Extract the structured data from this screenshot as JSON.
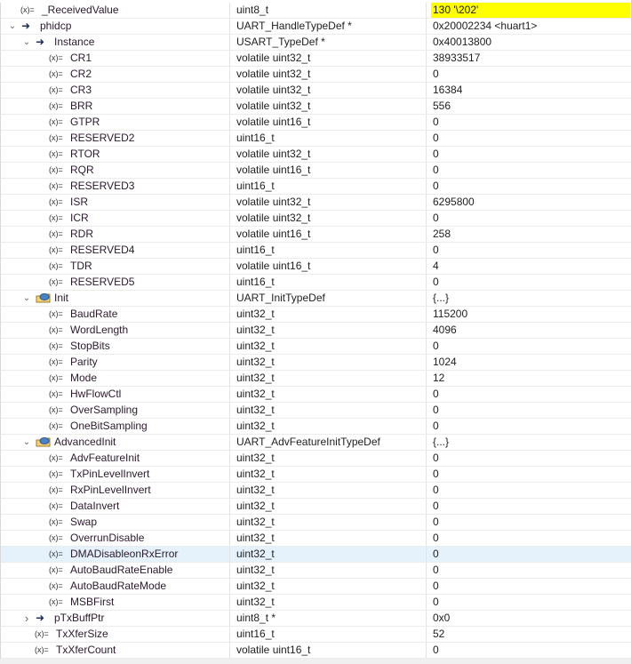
{
  "variables": [
    {
      "name": "_ReceivedValue",
      "type": "uint8_t",
      "value": "130 '\\202'",
      "level": 0,
      "kind": "leaf",
      "highlight_value": true
    },
    {
      "name": "phidcp",
      "type": "UART_HandleTypeDef *",
      "value": "0x20002234 <huart1>",
      "level": 0,
      "kind": "pointer",
      "expanded": true
    },
    {
      "name": "Instance",
      "type": "USART_TypeDef *",
      "value": "0x40013800",
      "level": 1,
      "kind": "pointer",
      "expanded": true
    },
    {
      "name": "CR1",
      "type": "volatile uint32_t",
      "value": "38933517",
      "level": 2,
      "kind": "leaf"
    },
    {
      "name": "CR2",
      "type": "volatile uint32_t",
      "value": "0",
      "level": 2,
      "kind": "leaf"
    },
    {
      "name": "CR3",
      "type": "volatile uint32_t",
      "value": "16384",
      "level": 2,
      "kind": "leaf"
    },
    {
      "name": "BRR",
      "type": "volatile uint32_t",
      "value": "556",
      "level": 2,
      "kind": "leaf"
    },
    {
      "name": "GTPR",
      "type": "volatile uint16_t",
      "value": "0",
      "level": 2,
      "kind": "leaf"
    },
    {
      "name": "RESERVED2",
      "type": "uint16_t",
      "value": "0",
      "level": 2,
      "kind": "leaf"
    },
    {
      "name": "RTOR",
      "type": "volatile uint32_t",
      "value": "0",
      "level": 2,
      "kind": "leaf"
    },
    {
      "name": "RQR",
      "type": "volatile uint16_t",
      "value": "0",
      "level": 2,
      "kind": "leaf"
    },
    {
      "name": "RESERVED3",
      "type": "uint16_t",
      "value": "0",
      "level": 2,
      "kind": "leaf"
    },
    {
      "name": "ISR",
      "type": "volatile uint32_t",
      "value": "6295800",
      "level": 2,
      "kind": "leaf"
    },
    {
      "name": "ICR",
      "type": "volatile uint32_t",
      "value": "0",
      "level": 2,
      "kind": "leaf"
    },
    {
      "name": "RDR",
      "type": "volatile uint16_t",
      "value": "258",
      "level": 2,
      "kind": "leaf"
    },
    {
      "name": "RESERVED4",
      "type": "uint16_t",
      "value": "0",
      "level": 2,
      "kind": "leaf"
    },
    {
      "name": "TDR",
      "type": "volatile uint16_t",
      "value": "4",
      "level": 2,
      "kind": "leaf"
    },
    {
      "name": "RESERVED5",
      "type": "uint16_t",
      "value": "0",
      "level": 2,
      "kind": "leaf"
    },
    {
      "name": "Init",
      "type": "UART_InitTypeDef",
      "value": "{...}",
      "level": 1,
      "kind": "struct",
      "expanded": true
    },
    {
      "name": "BaudRate",
      "type": "uint32_t",
      "value": "115200",
      "level": 2,
      "kind": "leaf"
    },
    {
      "name": "WordLength",
      "type": "uint32_t",
      "value": "4096",
      "level": 2,
      "kind": "leaf"
    },
    {
      "name": "StopBits",
      "type": "uint32_t",
      "value": "0",
      "level": 2,
      "kind": "leaf"
    },
    {
      "name": "Parity",
      "type": "uint32_t",
      "value": "1024",
      "level": 2,
      "kind": "leaf"
    },
    {
      "name": "Mode",
      "type": "uint32_t",
      "value": "12",
      "level": 2,
      "kind": "leaf"
    },
    {
      "name": "HwFlowCtl",
      "type": "uint32_t",
      "value": "0",
      "level": 2,
      "kind": "leaf"
    },
    {
      "name": "OverSampling",
      "type": "uint32_t",
      "value": "0",
      "level": 2,
      "kind": "leaf"
    },
    {
      "name": "OneBitSampling",
      "type": "uint32_t",
      "value": "0",
      "level": 2,
      "kind": "leaf"
    },
    {
      "name": "AdvancedInit",
      "type": "UART_AdvFeatureInitTypeDef",
      "value": "{...}",
      "level": 1,
      "kind": "struct",
      "expanded": true
    },
    {
      "name": "AdvFeatureInit",
      "type": "uint32_t",
      "value": "0",
      "level": 2,
      "kind": "leaf"
    },
    {
      "name": "TxPinLevelInvert",
      "type": "uint32_t",
      "value": "0",
      "level": 2,
      "kind": "leaf"
    },
    {
      "name": "RxPinLevelInvert",
      "type": "uint32_t",
      "value": "0",
      "level": 2,
      "kind": "leaf"
    },
    {
      "name": "DataInvert",
      "type": "uint32_t",
      "value": "0",
      "level": 2,
      "kind": "leaf"
    },
    {
      "name": "Swap",
      "type": "uint32_t",
      "value": "0",
      "level": 2,
      "kind": "leaf"
    },
    {
      "name": "OverrunDisable",
      "type": "uint32_t",
      "value": "0",
      "level": 2,
      "kind": "leaf"
    },
    {
      "name": "DMADisableonRxError",
      "type": "uint32_t",
      "value": "0",
      "level": 2,
      "kind": "leaf",
      "selected": true
    },
    {
      "name": "AutoBaudRateEnable",
      "type": "uint32_t",
      "value": "0",
      "level": 2,
      "kind": "leaf"
    },
    {
      "name": "AutoBaudRateMode",
      "type": "uint32_t",
      "value": "0",
      "level": 2,
      "kind": "leaf"
    },
    {
      "name": "MSBFirst",
      "type": "uint32_t",
      "value": "0",
      "level": 2,
      "kind": "leaf"
    },
    {
      "name": "pTxBuffPtr",
      "type": "uint8_t *",
      "value": "0x0",
      "level": 1,
      "kind": "pointer",
      "expanded": false
    },
    {
      "name": "TxXferSize",
      "type": "uint16_t",
      "value": "52",
      "level": 1,
      "kind": "leaf"
    },
    {
      "name": "TxXferCount",
      "type": "volatile uint16_t",
      "value": "0",
      "level": 1,
      "kind": "leaf"
    }
  ],
  "icons": {
    "leaf": "variable-icon",
    "pointer": "pointer-arrow-icon",
    "struct": "struct-icon"
  },
  "colors": {
    "value_highlight": "#ffff00",
    "selection": "#e5f1fb"
  }
}
